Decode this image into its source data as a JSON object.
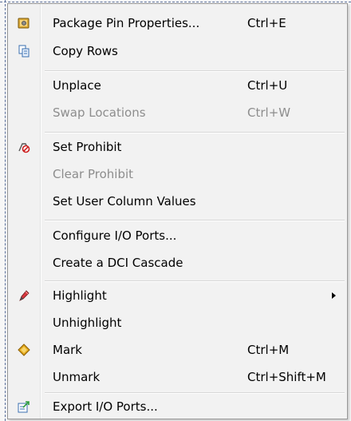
{
  "menu": {
    "items": [
      {
        "label": "Package Pin Properties...",
        "shortcut": "Ctrl+E",
        "icon": "package-properties-icon",
        "enabled": true
      },
      {
        "label": "Copy Rows",
        "shortcut": "",
        "icon": "copy-icon",
        "enabled": true
      },
      {
        "label": "Unplace",
        "shortcut": "Ctrl+U",
        "icon": "",
        "enabled": true
      },
      {
        "label": "Swap Locations",
        "shortcut": "Ctrl+W",
        "icon": "",
        "enabled": false
      },
      {
        "label": "Set Prohibit",
        "shortcut": "",
        "icon": "prohibit-icon",
        "enabled": true
      },
      {
        "label": "Clear Prohibit",
        "shortcut": "",
        "icon": "",
        "enabled": false
      },
      {
        "label": "Set User Column Values",
        "shortcut": "",
        "icon": "",
        "enabled": true
      },
      {
        "label": "Configure I/O Ports...",
        "shortcut": "",
        "icon": "",
        "enabled": true
      },
      {
        "label": "Create a DCI Cascade",
        "shortcut": "",
        "icon": "",
        "enabled": true
      },
      {
        "label": "Highlight",
        "shortcut": "",
        "icon": "highlight-pen-icon",
        "enabled": true,
        "submenu": true
      },
      {
        "label": "Unhighlight",
        "shortcut": "",
        "icon": "",
        "enabled": true
      },
      {
        "label": "Mark",
        "shortcut": "Ctrl+M",
        "icon": "mark-diamond-icon",
        "enabled": true
      },
      {
        "label": "Unmark",
        "shortcut": "Ctrl+Shift+M",
        "icon": "",
        "enabled": true
      },
      {
        "label": "Export I/O Ports...",
        "shortcut": "",
        "icon": "export-icon",
        "enabled": true
      }
    ]
  },
  "colors": {
    "menu_background": "#f2f2f2",
    "menu_border": "#979797",
    "disabled_text": "#8d8d8d",
    "backdrop_dash": "#5a6f9a"
  }
}
